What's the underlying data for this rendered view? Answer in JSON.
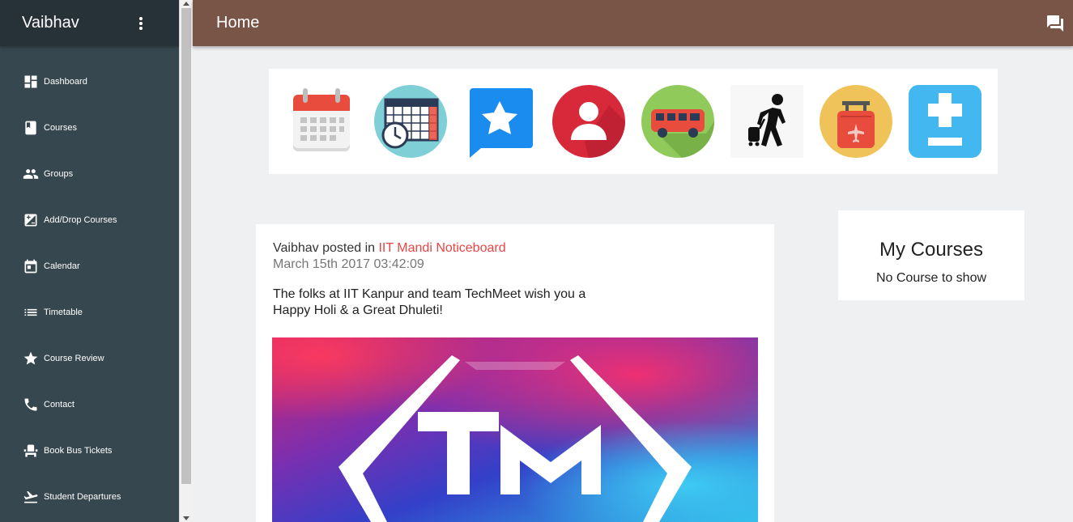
{
  "sidebar": {
    "user_name": "Vaibhav",
    "items": [
      {
        "label": "Dashboard",
        "icon": "dashboard-icon"
      },
      {
        "label": "Courses",
        "icon": "book-icon"
      },
      {
        "label": "Groups",
        "icon": "group-icon"
      },
      {
        "label": "Add/Drop Courses",
        "icon": "plus-minus-box-icon"
      },
      {
        "label": "Calendar",
        "icon": "calendar-icon"
      },
      {
        "label": "Timetable",
        "icon": "list-icon"
      },
      {
        "label": "Course Review",
        "icon": "star-icon"
      },
      {
        "label": "Contact",
        "icon": "phone-icon"
      },
      {
        "label": "Book Bus Tickets",
        "icon": "bus-seat-icon"
      },
      {
        "label": "Student Departures",
        "icon": "flight-takeoff-icon"
      }
    ]
  },
  "header": {
    "title": "Home",
    "chat_icon": "chat-bubbles-icon"
  },
  "quicklinks": [
    {
      "icon": "calendar-app-icon"
    },
    {
      "icon": "timetable-clock-icon"
    },
    {
      "icon": "review-star-bubble-icon"
    },
    {
      "icon": "contact-person-icon"
    },
    {
      "icon": "bus-icon"
    },
    {
      "icon": "traveler-icon"
    },
    {
      "icon": "luggage-flight-icon"
    },
    {
      "icon": "add-drop-icon"
    }
  ],
  "post": {
    "author": "Vaibhav",
    "posted_in": "posted in",
    "board": "IIT Mandi Noticeboard",
    "date": "March 15th 2017 03:42:09",
    "body_line1": "The folks at IIT Kanpur and team TechMeet wish you a",
    "body_line2": "Happy Holi & a Great Dhuleti!"
  },
  "my_courses": {
    "title": "My Courses",
    "empty": "No Course to show"
  },
  "colors": {
    "sidebar": "#37474f",
    "sidebar_header": "#263238",
    "topbar": "#795548",
    "link": "#e84545"
  }
}
